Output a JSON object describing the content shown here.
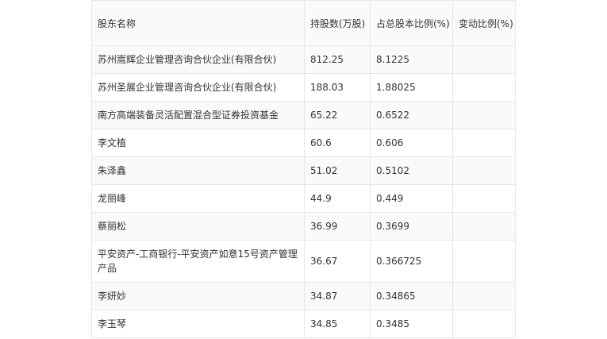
{
  "table": {
    "headers": {
      "name": "股东名称",
      "shares": "持股数(万股)",
      "ratio": "占总股本比例(%)",
      "change": "变动比例(%)"
    },
    "rows": [
      {
        "name": "苏州嵩辉企业管理咨询合伙企业(有限合伙)",
        "shares": "812.25",
        "ratio": "8.1225",
        "change": ""
      },
      {
        "name": "苏州圣展企业管理咨询合伙企业(有限合伙)",
        "shares": "188.03",
        "ratio": "1.88025",
        "change": ""
      },
      {
        "name": "南方高端装备灵活配置混合型证券投资基金",
        "shares": "65.22",
        "ratio": "0.6522",
        "change": ""
      },
      {
        "name": "李文植",
        "shares": "60.6",
        "ratio": "0.606",
        "change": ""
      },
      {
        "name": "朱泽鑫",
        "shares": "51.02",
        "ratio": "0.5102",
        "change": ""
      },
      {
        "name": "龙丽峰",
        "shares": "44.9",
        "ratio": "0.449",
        "change": ""
      },
      {
        "name": "蔡丽松",
        "shares": "36.99",
        "ratio": "0.3699",
        "change": ""
      },
      {
        "name": "平安资产-工商银行-平安资产如意15号资产管理产品",
        "shares": "36.67",
        "ratio": "0.366725",
        "change": ""
      },
      {
        "name": "李妍妙",
        "shares": "34.87",
        "ratio": "0.34865",
        "change": ""
      },
      {
        "name": "李玉琴",
        "shares": "34.85",
        "ratio": "0.3485",
        "change": ""
      }
    ]
  }
}
